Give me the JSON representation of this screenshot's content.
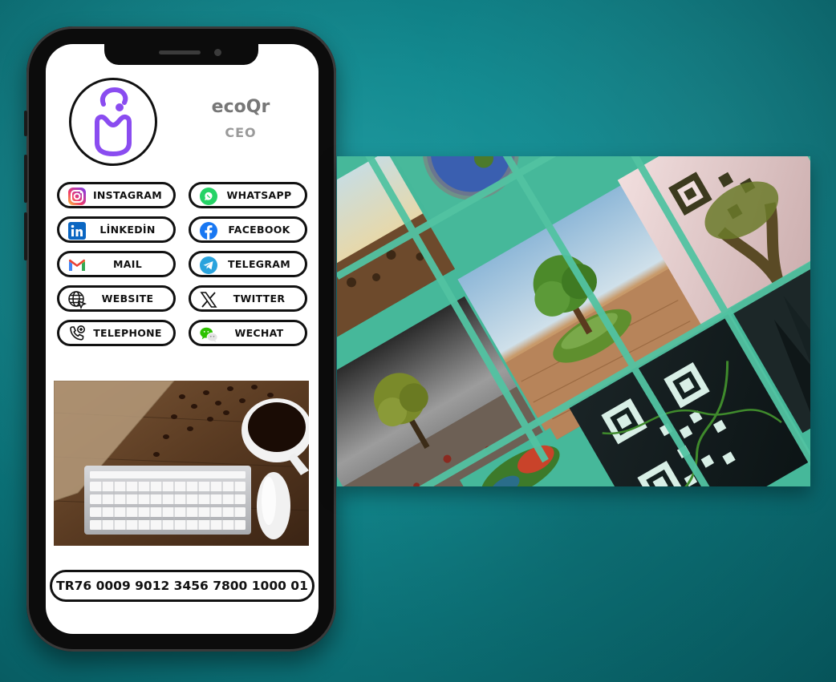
{
  "profile": {
    "name": "ecoQr",
    "role": "CEO"
  },
  "links": [
    {
      "label": "INSTAGRAM",
      "icon": "instagram-icon"
    },
    {
      "label": "WHATSAPP",
      "icon": "whatsapp-icon"
    },
    {
      "label": "LİNKEDİN",
      "icon": "linkedin-icon"
    },
    {
      "label": "FACEBOOK",
      "icon": "facebook-icon"
    },
    {
      "label": "MAIL",
      "icon": "mail-icon"
    },
    {
      "label": "TELEGRAM",
      "icon": "telegram-icon"
    },
    {
      "label": "WEBSITE",
      "icon": "globe-icon"
    },
    {
      "label": "TWITTER",
      "icon": "x-icon"
    },
    {
      "label": "TELEPHONE",
      "icon": "phone-icon"
    },
    {
      "label": "WECHAT",
      "icon": "wechat-icon"
    }
  ],
  "iban": "TR76 0009 9012 3456 7800 1000 01",
  "colors": {
    "background": "#128a90",
    "accent": "#46b89a",
    "avatar_purple": "#8a4cf0"
  }
}
